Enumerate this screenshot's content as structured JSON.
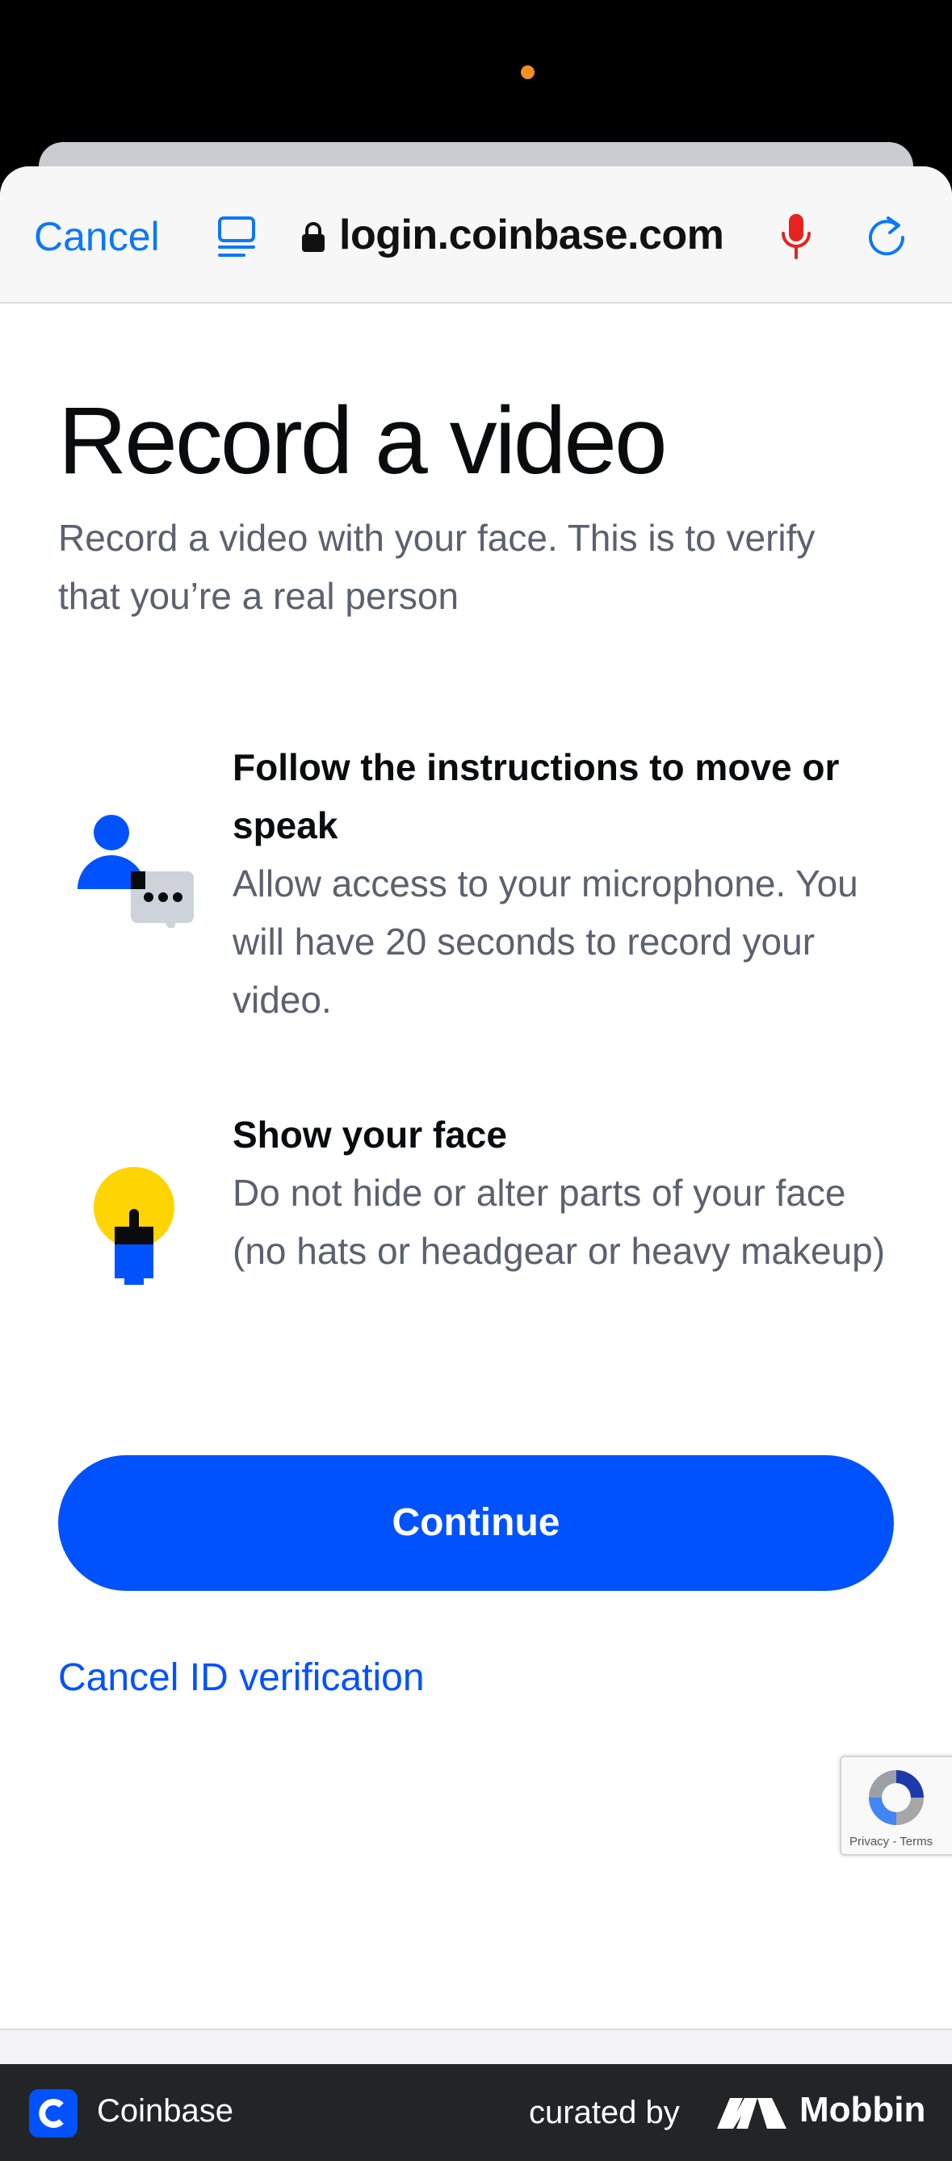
{
  "browser": {
    "cancel_label": "Cancel",
    "url": "login.coinbase.com"
  },
  "page": {
    "title": "Record a video",
    "subtitle": "Record a video with your face. This is to verify that you’re a real person"
  },
  "steps": [
    {
      "title": "Follow the instructions to move or speak",
      "description": "Allow access to your microphone. You will have 20 seconds to record your video.",
      "icon": "person-speaking-icon"
    },
    {
      "title": "Show your face",
      "description": "Do not hide or alter parts of your face (no hats or headgear or heavy makeup)",
      "icon": "face-sun-icon"
    }
  ],
  "actions": {
    "continue_label": "Continue",
    "cancel_verification_label": "Cancel ID verification"
  },
  "recaptcha": {
    "links": "Privacy - Terms"
  },
  "footer": {
    "app_name": "Coinbase",
    "curated_by": "curated by",
    "brand": "Mobbin"
  },
  "colors": {
    "primary": "#0052ff",
    "safari_blue": "#0a79f7",
    "mic_red": "#e5231f",
    "icon_yellow": "#ffd400"
  }
}
